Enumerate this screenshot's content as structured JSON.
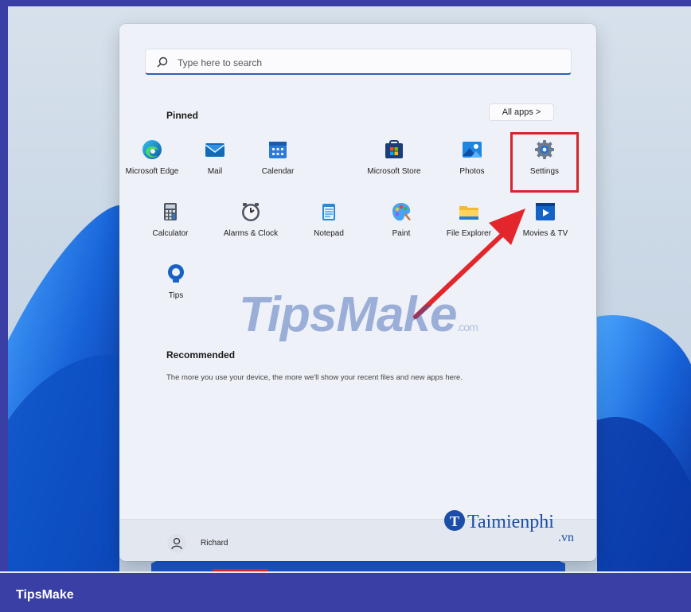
{
  "search": {
    "placeholder": "Type here to search"
  },
  "pinned": {
    "title": "Pinned",
    "all_apps_label": "All apps >",
    "apps": [
      {
        "label": "Microsoft Edge",
        "icon": "edge-icon"
      },
      {
        "label": "Mail",
        "icon": "mail-icon"
      },
      {
        "label": "Calendar",
        "icon": "calendar-icon"
      },
      {
        "label": "Microsoft Store",
        "icon": "store-icon"
      },
      {
        "label": "Photos",
        "icon": "photos-icon"
      },
      {
        "label": "Settings",
        "icon": "gear-icon"
      },
      {
        "label": "Calculator",
        "icon": "calculator-icon"
      },
      {
        "label": "Alarms & Clock",
        "icon": "clock-icon"
      },
      {
        "label": "Notepad",
        "icon": "notepad-icon"
      },
      {
        "label": "Paint",
        "icon": "paint-icon"
      },
      {
        "label": "File Explorer",
        "icon": "folder-icon"
      },
      {
        "label": "Movies & TV",
        "icon": "movies-icon"
      },
      {
        "label": "Tips",
        "icon": "tips-icon"
      }
    ]
  },
  "recommended": {
    "title": "Recommended",
    "text": "The more you use your device, the more we'll show your recent files and new apps here."
  },
  "footer": {
    "user_name": "Richard"
  },
  "watermarks": {
    "center": "TipsMake",
    "center_suffix": ".com",
    "corner": "Taimienphi",
    "corner_suffix": ".vn"
  },
  "brand": {
    "label": "TipsMake"
  },
  "colors": {
    "accent": "#2d5fb7",
    "highlight": "#d6262b",
    "brand_bar": "#3a3fa6"
  }
}
